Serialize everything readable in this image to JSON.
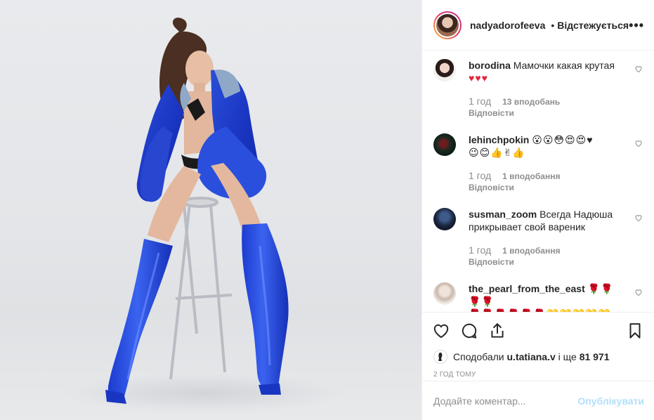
{
  "header": {
    "username": "nadyadorofeeva",
    "follow_state": "Відстежується",
    "more_label": "•••"
  },
  "comments": [
    {
      "username": "borodina",
      "text": "Мамочки какая крутая",
      "emoji": "♥♥♥",
      "time": "1 год",
      "likes": "13 вподобань",
      "reply": "Відповісти"
    },
    {
      "username": "lehinchpokin",
      "text": "",
      "emoji": "😮😮😳😍😍♥",
      "emoji2": "😉😊👍✌👍",
      "time": "1 год",
      "likes": "1 вподобання",
      "reply": "Відповісти"
    },
    {
      "username": "susman_zoom",
      "text": "Всегда Надюша прикрывает свой вареник",
      "time": "1 год",
      "likes": "1 вподобання",
      "reply": "Відповісти"
    },
    {
      "username": "the_pearl_from_the_east",
      "text": "",
      "emoji": "🌹🌹🌹🌹",
      "emoji2": "🌹🌹🌹🌹🌹🌹💛💛💛💛💛"
    }
  ],
  "likes": {
    "prefix": "Сподобали",
    "user": "u.tatiana.v",
    "middle": "і ще",
    "count": "81 971"
  },
  "timestamp": "2 год тому",
  "add_comment": {
    "placeholder": "Додайте коментар...",
    "post_label": "Опублікувати"
  },
  "colors": {
    "accent_blue": "#b2dffc",
    "text": "#262626",
    "muted": "#8e8e8e",
    "heart_red": "#e3263b"
  },
  "icons": {
    "verified": "verified-badge-icon",
    "like": "heart-outline-icon",
    "comment": "speech-bubble-icon",
    "share": "share-icon",
    "save": "bookmark-icon"
  }
}
